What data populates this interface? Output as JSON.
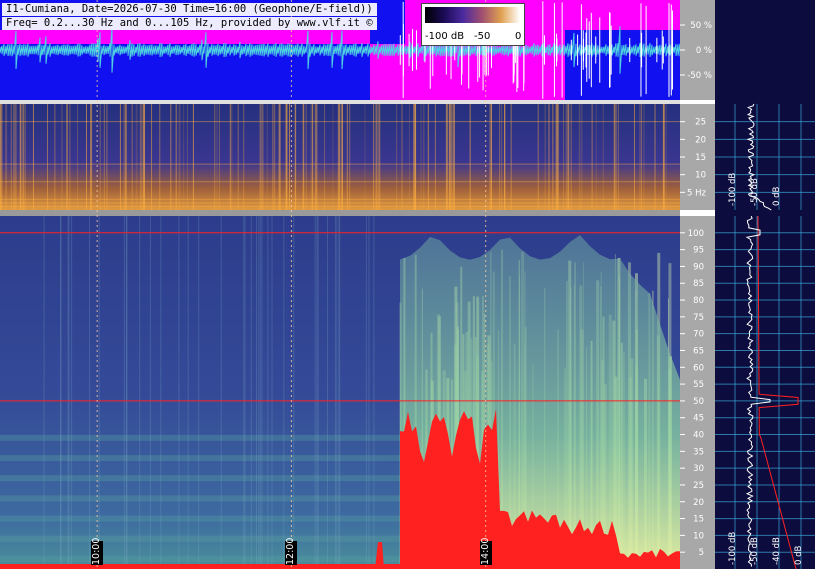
{
  "header": {
    "line1": "I1-Cumiana, Date=2026-07-30 Time=16:00 (Geophone/E-field))",
    "line2": "Freq= 0.2...30 Hz and 0...105 Hz, provided by www.vlf.it ©"
  },
  "legend": {
    "min_label": "-100 dB",
    "mid_label": "-50",
    "max_label": "0"
  },
  "colors": {
    "background": "#0c0c3e",
    "waveform_bg": "#1010f0",
    "waveform_magenta": "#ff00ff",
    "waveform_trace": "#4dd0e1",
    "spectro_low": "#202a8a",
    "spectro_high": "#ffb040",
    "highlight_red": "#ff2020",
    "axis_gray": "#a8a8a8",
    "grid_line": "#3aa8d8"
  },
  "chart_data": [
    {
      "type": "line",
      "panel": "waveform",
      "y_tick_labels": [
        "50 %",
        "0 %",
        "-50 %"
      ],
      "y_ticks": [
        50,
        0,
        -50
      ],
      "ylim": [
        -100,
        100
      ]
    },
    {
      "type": "heatmap",
      "panel": "spectrogram-low",
      "y_tick_labels": [
        "25",
        "20",
        "15",
        "10",
        "5 Hz"
      ],
      "y_ticks": [
        25,
        20,
        15,
        10,
        5
      ],
      "ylim": [
        0,
        30
      ],
      "line_frequencies": [
        1,
        2,
        3,
        8,
        13,
        25
      ]
    },
    {
      "type": "heatmap",
      "panel": "spectrogram-high",
      "x_tick_labels": [
        "10:00",
        "12:00",
        "14:00"
      ],
      "x_ticks": [
        10,
        12,
        14
      ],
      "xlim": [
        9,
        16
      ],
      "y_tick_labels": [
        "100",
        "95",
        "90",
        "85",
        "80",
        "75",
        "70",
        "65",
        "60",
        "55",
        "50",
        "45",
        "40",
        "35",
        "30",
        "25",
        "20",
        "15",
        "10",
        "5"
      ],
      "y_ticks": [
        100,
        95,
        90,
        85,
        80,
        75,
        70,
        65,
        60,
        55,
        50,
        45,
        40,
        35,
        30,
        25,
        20,
        15,
        10,
        5
      ],
      "ylim": [
        0,
        105
      ],
      "line_frequencies": [
        100,
        50
      ]
    },
    {
      "type": "line",
      "panel": "spectrum-low",
      "x_tick_labels": [
        "-100 dB",
        "-50 dB",
        "0 dB"
      ],
      "y_ticks": [
        25,
        20,
        15,
        10,
        5
      ],
      "ylim": [
        0,
        30
      ]
    },
    {
      "type": "line",
      "panel": "spectrum-high",
      "x_tick_labels": [
        "-100 dB",
        "-50 dB",
        "-40 dB",
        "0 dB"
      ],
      "y_ticks": [
        100,
        95,
        90,
        85,
        80,
        75,
        70,
        65,
        60,
        55,
        50,
        45,
        40,
        35,
        30,
        25,
        20,
        15,
        10,
        5
      ],
      "ylim": [
        0,
        105
      ]
    }
  ]
}
